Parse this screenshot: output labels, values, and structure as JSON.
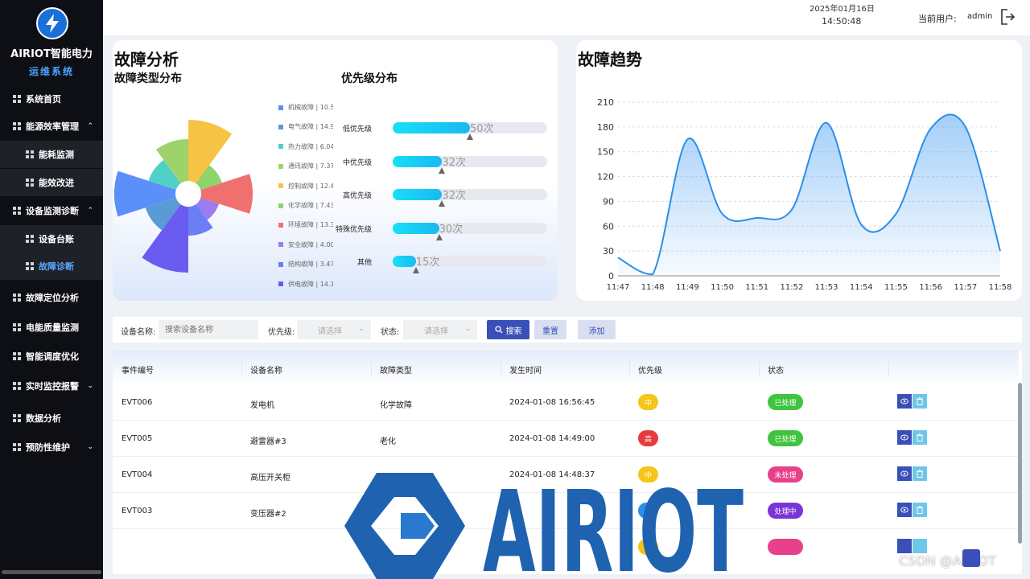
{
  "app": {
    "name": "AIRIOT智能电力",
    "subtitle": "运维系统"
  },
  "header": {
    "date": "2025年01月16日",
    "time": "14:50:48",
    "user_label": "当前用户:",
    "user": "admin"
  },
  "sidebar": {
    "items": [
      {
        "label": "系统首页"
      },
      {
        "label": "能源效率管理"
      },
      {
        "label": "能耗监测"
      },
      {
        "label": "能效改进"
      },
      {
        "label": "设备监测诊断"
      },
      {
        "label": "设备台账"
      },
      {
        "label": "故障诊断"
      },
      {
        "label": "故障定位分析"
      },
      {
        "label": "电能质量监测"
      },
      {
        "label": "智能调度优化"
      },
      {
        "label": "实时监控报警"
      },
      {
        "label": "数据分析"
      },
      {
        "label": "预防性维护"
      }
    ]
  },
  "fault": {
    "title": "故障分析",
    "type_title": "故障类型分布",
    "priority_title": "优先级分布",
    "legend": [
      {
        "label": "机械故障 | 10.5",
        "color": "#5b8ff9"
      },
      {
        "label": "电气故障 | 14.9",
        "color": "#5a9bd5"
      },
      {
        "label": "热力故障 | 6.04",
        "color": "#4fd1c5"
      },
      {
        "label": "通讯故障 | 7.37",
        "color": "#9ed36a"
      },
      {
        "label": "控制故障 | 12.4",
        "color": "#f6c344"
      },
      {
        "label": "化学故障 | 7.43",
        "color": "#8fd36b"
      },
      {
        "label": "环境故障 | 13.3",
        "color": "#f07070"
      },
      {
        "label": "安全故障 | 4.00",
        "color": "#9b7cf0"
      },
      {
        "label": "结构故障 | 3.47",
        "color": "#6c7ef5"
      },
      {
        "label": "供电故障 | 14.1",
        "color": "#6a5cf0"
      }
    ],
    "priority": [
      {
        "label": "低优先级",
        "value": 50,
        "text": "50次"
      },
      {
        "label": "中优先级",
        "value": 32,
        "text": "32次"
      },
      {
        "label": "高优先级",
        "value": 32,
        "text": "32次"
      },
      {
        "label": "特殊优先级",
        "value": 30,
        "text": "30次"
      },
      {
        "label": "其他",
        "value": 15,
        "text": "15次"
      }
    ]
  },
  "trend": {
    "title": "故障趋势"
  },
  "chart_data": {
    "type": "area",
    "x": [
      "11:47",
      "11:48",
      "11:49",
      "11:50",
      "11:51",
      "11:52",
      "11:53",
      "11:54",
      "11:55",
      "11:56",
      "11:57",
      "11:58"
    ],
    "values": [
      22,
      2,
      165,
      75,
      70,
      80,
      185,
      62,
      75,
      178,
      180,
      30
    ],
    "ylim": [
      0,
      210
    ],
    "yticks": [
      0,
      30,
      60,
      90,
      120,
      150,
      180,
      210
    ],
    "grid": true,
    "color": "#2a8fe8"
  },
  "filters": {
    "device_label": "设备名称:",
    "device_placeholder": "搜索设备名称",
    "priority_label": "优先级:",
    "priority_placeholder": "请选择",
    "status_label": "状态:",
    "status_placeholder": "请选择",
    "search": "搜索",
    "reset": "重置",
    "add": "添加"
  },
  "table": {
    "headers": [
      "事件编号",
      "设备名称",
      "故障类型",
      "发生时间",
      "优先级",
      "状态"
    ],
    "rows": [
      {
        "id": "EVT006",
        "device": "发电机",
        "type": "化学故障",
        "time": "2024-01-08 16:56:45",
        "priority": "中",
        "priority_color": "#f5c518",
        "status": "已处理",
        "status_color": "#3ec43e"
      },
      {
        "id": "EVT005",
        "device": "避雷器#3",
        "type": "老化",
        "time": "2024-01-08 14:49:00",
        "priority": "高",
        "priority_color": "#e83a3a",
        "status": "已处理",
        "status_color": "#3ec43e"
      },
      {
        "id": "EVT004",
        "device": "高压开关柜",
        "type": "",
        "time": "2024-01-08 14:48:37",
        "priority": "中",
        "priority_color": "#f5c518",
        "status": "未处理",
        "status_color": "#e8408a"
      },
      {
        "id": "EVT003",
        "device": "变压器#2",
        "type": "",
        "time": "",
        "priority": "",
        "priority_color": "#2a8fe8",
        "status": "处理中",
        "status_color": "#7a34d8"
      }
    ]
  },
  "watermark": {
    "logo_text": "AIRIOT",
    "credit": "CSDN @AIRIOT"
  }
}
